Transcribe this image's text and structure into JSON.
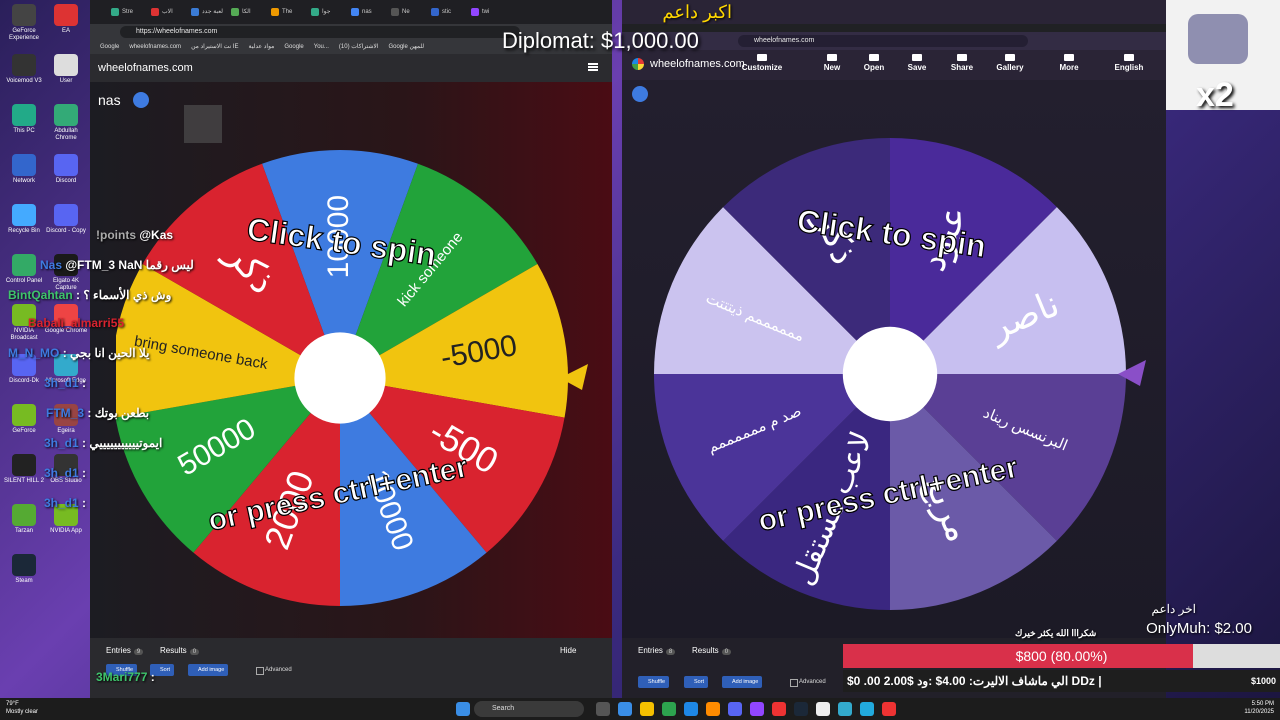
{
  "desktop": {
    "icons": [
      {
        "label": "GeForce Experience"
      },
      {
        "label": "EA"
      },
      {
        "label": "Voicemod V3"
      },
      {
        "label": "User"
      },
      {
        "label": "This PC"
      },
      {
        "label": "Abdullah Chrome"
      },
      {
        "label": "Network"
      },
      {
        "label": "Discord"
      },
      {
        "label": "Recycle Bin"
      },
      {
        "label": "Discord - Copy"
      },
      {
        "label": "Control Panel"
      },
      {
        "label": "Elgato 4K Capture"
      },
      {
        "label": "NVIDIA Broadcast"
      },
      {
        "label": "Google Chrome"
      },
      {
        "label": "Discord-Dk"
      },
      {
        "label": "Microsoft Edge"
      },
      {
        "label": "GeForce"
      },
      {
        "label": "Egeira"
      },
      {
        "label": "SILENT HILL 2"
      },
      {
        "label": "OBS Studio"
      },
      {
        "label": "Tarzan"
      },
      {
        "label": "NVIDIA App"
      },
      {
        "label": "Steam"
      }
    ]
  },
  "left_window": {
    "tabs": [
      {
        "label": "Stre"
      },
      {
        "label": "الاب"
      },
      {
        "label": "لعبة جدد"
      },
      {
        "label": "الكا"
      },
      {
        "label": "The"
      },
      {
        "label": "جوا"
      },
      {
        "label": "nas"
      },
      {
        "label": "Ne"
      },
      {
        "label": "stic"
      },
      {
        "label": "twi"
      }
    ],
    "url": "https://wheelofnames.com",
    "bookmarks": [
      "Google",
      "wheelofnames.com",
      "نت الاستيراد من IE",
      "مواد عدلية",
      "Google",
      "You...",
      "الاشتراكات (10)",
      "Google للمهن"
    ],
    "brand": "wheelofnames.com",
    "wheel_title": "nas",
    "wheel_center_text_top": "Click to spin",
    "wheel_center_text_bottom": "or press ctrl+enter",
    "slices": [
      {
        "label": "10000",
        "color": "#3e7be0"
      },
      {
        "label": "kick someone",
        "color": "#22a33a"
      },
      {
        "label": "-5000",
        "color": "#f1c40f"
      },
      {
        "label": "-500",
        "color": "#d9232f"
      },
      {
        "label": "10000",
        "color": "#3e7be0"
      },
      {
        "label": "2000",
        "color": "#d9232f"
      },
      {
        "label": "50000",
        "color": "#22a33a"
      },
      {
        "label": "bring someone back",
        "color": "#f1c40f"
      },
      {
        "label": "ذكر",
        "color": "#d9232f"
      }
    ],
    "tabs_bottom": {
      "entries_label": "Entries",
      "entries_count": "9",
      "results_label": "Results",
      "results_count": "0",
      "hide_label": "Hide"
    },
    "buttons": {
      "shuffle": "Shuffle",
      "sort": "Sort",
      "add_image": "Add image",
      "advanced": "Advanced"
    }
  },
  "right_window": {
    "url": "wheelofnames.com",
    "brand": "wheelofnames.com",
    "menu": [
      {
        "label": "Customize"
      },
      {
        "label": "New"
      },
      {
        "label": "Open"
      },
      {
        "label": "Save"
      },
      {
        "label": "Share"
      },
      {
        "label": "Gallery"
      },
      {
        "label": "More"
      },
      {
        "label": "English"
      }
    ],
    "wheel_center_text_top": "Click to spin",
    "wheel_center_text_bottom": "or press ctrl+enter",
    "slices": [
      {
        "label": "عبود",
        "color": "#4a2a9a"
      },
      {
        "label": "ناصر",
        "color": "#c7bff0"
      },
      {
        "label": "البرنسس ريناد",
        "color": "#5a3f95"
      },
      {
        "label": "مربع",
        "color": "#6b5aa8"
      },
      {
        "label": "لاعب مستقل",
        "color": "#3a2780"
      },
      {
        "label": "صد م ممممممم",
        "color": "#4b3499"
      },
      {
        "label": "ممممممم ذيتتتت",
        "color": "#cbc3ef"
      },
      {
        "label": "ذكر",
        "color": "#3c2a7a"
      }
    ],
    "tabs_bottom": {
      "entries_label": "Entries",
      "entries_count": "8",
      "results_label": "Results",
      "results_count": "0"
    },
    "buttons": {
      "shuffle": "Shuffle",
      "sort": "Sort",
      "add_image": "Add image",
      "advanced": "Advanced"
    }
  },
  "chat": [
    {
      "user": "!points",
      "text": "@Kas",
      "color": "#aaaaaa"
    },
    {
      "user": "Nas",
      "text": "@FTM_3 NaN ليس رقما",
      "color": "#3e7be0"
    },
    {
      "user": "BintQahtan",
      "text": ": وش ذي الأسماء ؟",
      "color": "#3ec46b"
    },
    {
      "user": "Babali_almarri55",
      "text": "",
      "color": "#d9232f"
    },
    {
      "user": "M_N_MO",
      "text": ": يلا الحين انا بجي",
      "color": "#3e7be0"
    },
    {
      "user": "3h_d1",
      "text": ":",
      "color": "#3e7be0"
    },
    {
      "user": "FTM_3",
      "text": ": بطعن بوتك",
      "color": "#3e7be0"
    },
    {
      "user": "3h_d1",
      "text": ": ايموتيييييييييييي",
      "color": "#3e7be0"
    },
    {
      "user": "3h_d1",
      "text": ":",
      "color": "#3e7be0"
    },
    {
      "user": "3h_d1",
      "text": ":",
      "color": "#3e7be0"
    },
    {
      "user": "3Mari777",
      "text": ":",
      "color": "#3ec46b"
    }
  ],
  "overlays": {
    "donation_name": "اكبر داعم",
    "donation_amount": "Diplomat: $1,000.00",
    "x2": "x2",
    "last_supporter_label": "اخر داعم",
    "last_supporter": "OnlyMuh: $2.00",
    "thanks": "شكرااا الله يكثر خيرك",
    "goal_label": "$800 (80.00%)",
    "goal_fraction": 0.8,
    "goal_strip": "$0    .00   2.00$ الي ماشاف الاليرت:   4.00$ :ود   DDz |",
    "goal_target": "$1000"
  },
  "taskbar": {
    "weather_temp": "79°F",
    "weather_desc": "Mostly clear",
    "search_placeholder": "Search",
    "time": "5:50 PM",
    "date": "11/20/2025"
  }
}
